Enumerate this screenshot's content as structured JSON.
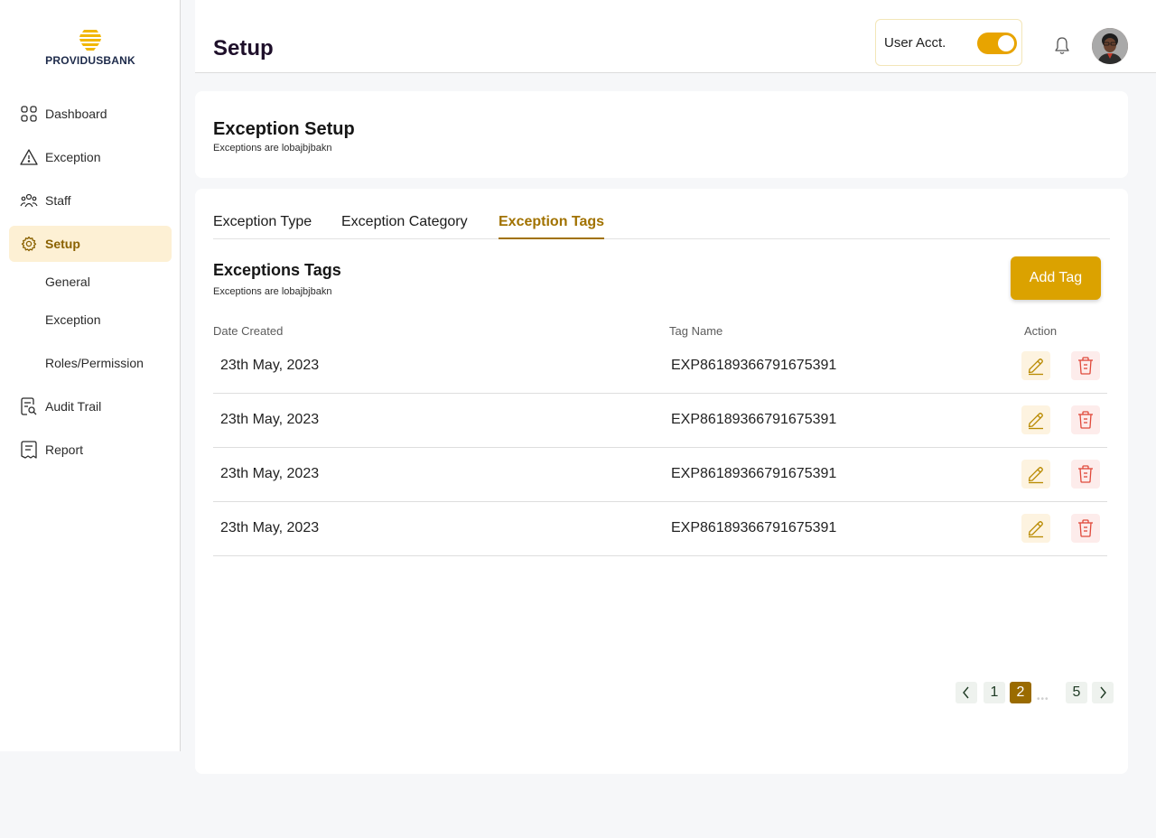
{
  "brand": {
    "name": "PROVIDUSBANK",
    "accent": "#dba200",
    "active_color": "#a17200"
  },
  "sidebar": {
    "items": [
      {
        "label": "Dashboard",
        "icon": "grid-icon"
      },
      {
        "label": "Exception",
        "icon": "warning-icon"
      },
      {
        "label": "Staff",
        "icon": "staff-icon"
      },
      {
        "label": "Setup",
        "icon": "gear-icon",
        "active": true
      },
      {
        "label": "Audit Trail",
        "icon": "audit-icon"
      },
      {
        "label": "Report",
        "icon": "report-icon"
      }
    ],
    "sub_items": [
      "General",
      "Exception",
      "Roles/Permission"
    ]
  },
  "header": {
    "title": "Setup",
    "user_toggle_label": "User Acct.",
    "user_toggle_on": true
  },
  "setup_card": {
    "title": "Exception Setup",
    "subtitle": "Exceptions are lobajbjbakn"
  },
  "tabs": [
    {
      "label": "Exception Type"
    },
    {
      "label": "Exception Category"
    },
    {
      "label": "Exception Tags",
      "active": true
    }
  ],
  "tags_section": {
    "title": "Exceptions Tags",
    "subtitle": "Exceptions are lobajbjbakn",
    "add_button": "Add Tag",
    "columns": [
      "Date Created",
      "Tag Name",
      "Action"
    ],
    "rows": [
      {
        "date": "23th May, 2023",
        "tag": "EXP86189366791675391"
      },
      {
        "date": "23th May, 2023",
        "tag": "EXP86189366791675391"
      },
      {
        "date": "23th May, 2023",
        "tag": "EXP86189366791675391"
      },
      {
        "date": "23th May, 2023",
        "tag": "EXP86189366791675391"
      }
    ]
  },
  "pagination": {
    "pages": [
      "1",
      "2",
      "5"
    ],
    "current": "2",
    "ellipsis": "•••"
  }
}
